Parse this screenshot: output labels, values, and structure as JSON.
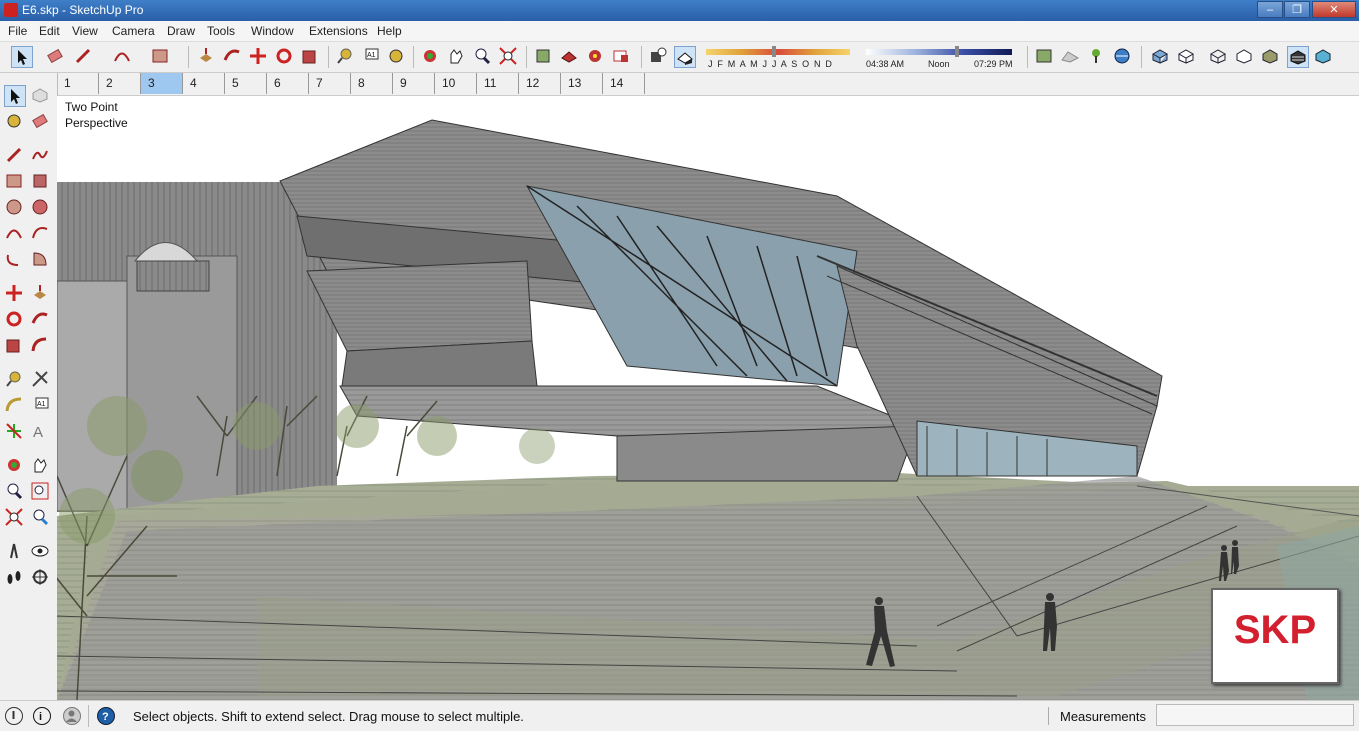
{
  "window": {
    "title": "E6.skp - SketchUp Pro"
  },
  "menu": [
    "File",
    "Edit",
    "View",
    "Camera",
    "Draw",
    "Tools",
    "Window",
    "Extensions",
    "Help"
  ],
  "shadow": {
    "months": "J F M A M J J A S O N D",
    "time_start": "04:38 AM",
    "time_mid": "Noon",
    "time_end": "07:29 PM"
  },
  "scenes": {
    "tabs": [
      "1",
      "2",
      "3",
      "4",
      "5",
      "6",
      "7",
      "8",
      "9",
      "10",
      "11",
      "12",
      "13",
      "14"
    ],
    "active": "3"
  },
  "viewport": {
    "camera_label_line1": "Two Point",
    "camera_label_line2": "Perspective",
    "badge": "SKP"
  },
  "status": {
    "message": "Select objects. Shift to extend select. Drag mouse to select multiple.",
    "measurements_label": "Measurements",
    "measurements_value": ""
  },
  "colors": {
    "title_bar": "#2a5fa8",
    "badge_red": "#d3202e",
    "active_tab": "#9ec8f0"
  },
  "icons": {
    "left_tools": [
      "select",
      "component",
      "paint-bucket",
      "eraser",
      "pencil",
      "freehand",
      "rectangle",
      "rotated-rect",
      "circle",
      "polygon",
      "arc",
      "pie",
      "2pt-arc",
      "3pt-arc",
      "move",
      "push-pull",
      "rotate",
      "follow-me",
      "scale",
      "offset",
      "tape-measure",
      "dimension",
      "protractor",
      "text",
      "axes",
      "3d-text",
      "orbit",
      "pan",
      "zoom",
      "zoom-window",
      "zoom-extents",
      "previous",
      "position-camera",
      "look-around",
      "walk",
      "section-plane"
    ]
  }
}
